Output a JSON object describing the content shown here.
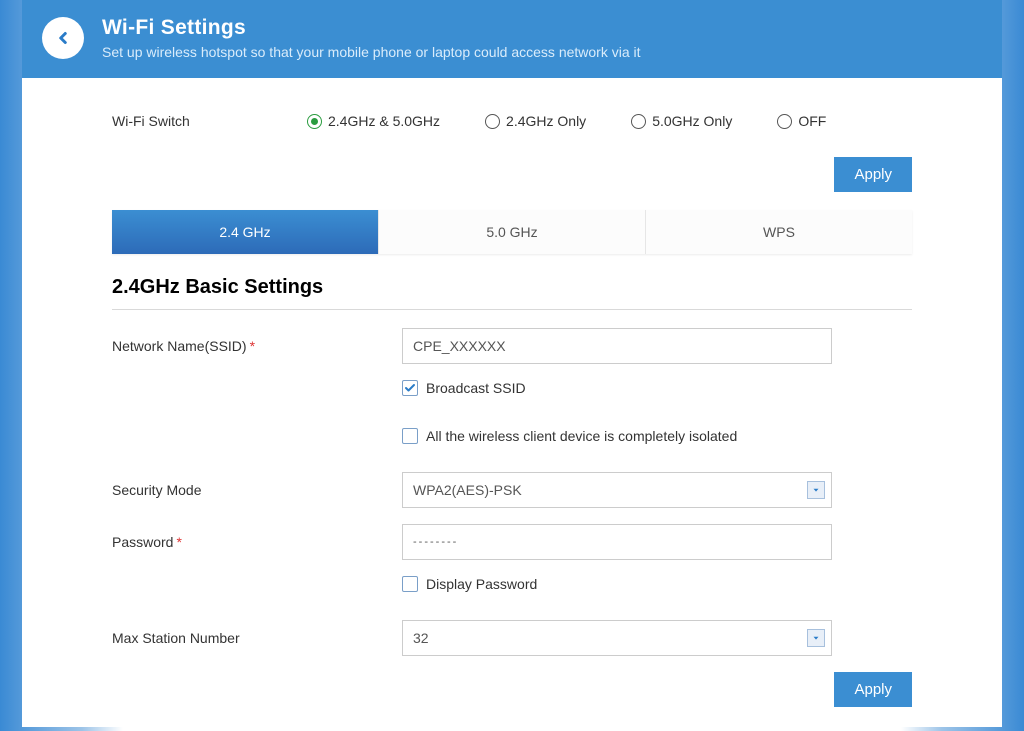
{
  "header": {
    "title": "Wi-Fi Settings",
    "subtitle": "Set up wireless hotspot so that your mobile phone or laptop could access network via it"
  },
  "switch": {
    "label": "Wi-Fi Switch",
    "options": {
      "both": "2.4GHz & 5.0GHz",
      "g24": "2.4GHz Only",
      "g50": "5.0GHz Only",
      "off": "OFF"
    }
  },
  "buttons": {
    "apply": "Apply"
  },
  "tabs": {
    "g24": "2.4 GHz",
    "g50": "5.0 GHz",
    "wps": "WPS"
  },
  "section": {
    "title": "2.4GHz Basic Settings"
  },
  "form": {
    "ssid_label": "Network Name(SSID)",
    "ssid_value": "CPE_XXXXXX",
    "broadcast": "Broadcast SSID",
    "isolated": "All the wireless client device is completely isolated",
    "security_label": "Security Mode",
    "security_value": "WPA2(AES)-PSK",
    "password_label": "Password",
    "password_value": "--------",
    "display_pw": "Display Password",
    "max_station_label": "Max Station Number",
    "max_station_value": "32",
    "required": "*"
  },
  "colors": {
    "primary": "#3b8ed2",
    "radio_green": "#2a9c3f"
  }
}
